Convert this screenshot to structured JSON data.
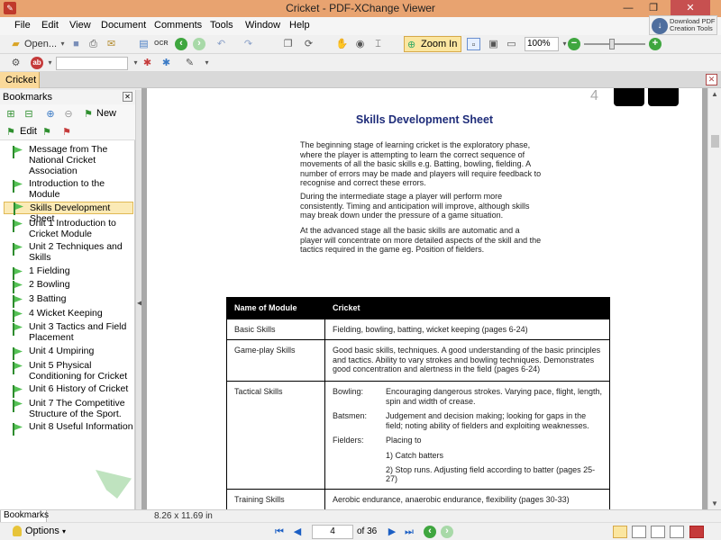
{
  "window": {
    "title": "Cricket - PDF-XChange Viewer"
  },
  "menu": [
    "File",
    "Edit",
    "View",
    "Document",
    "Comments",
    "Tools",
    "Window",
    "Help"
  ],
  "download": {
    "line1": "Download PDF",
    "line2": "Creation Tools"
  },
  "toolbar": {
    "open_label": "Open...",
    "ocr_label": "OCR",
    "zoom_label": "Zoom In",
    "zoom_percent": "100%"
  },
  "tab": {
    "label": "Cricket"
  },
  "bookmarks_panel": {
    "title": "Bookmarks",
    "new_label": "New",
    "edit_label": "Edit",
    "items": [
      "Message from The National Cricket Association",
      "Introduction to the Module",
      "Skills Development Sheet",
      "Unit 1 Introduction to Cricket Module",
      "Unit 2  Techniques and Skills",
      "1 Fielding",
      "2 Bowling",
      "3 Batting",
      "4 Wicket Keeping",
      "Unit 3  Tactics and Field Placement",
      "Unit 4  Umpiring",
      "Unit 5  Physical Conditioning for Cricket",
      "Unit 6 History of Cricket",
      "Unit 7 The Competitive Structure of the Sport.",
      "Unit 8  Useful Information"
    ],
    "selected_index": 2
  },
  "document": {
    "header_number": "4",
    "title": "Skills Development Sheet",
    "paragraphs": [
      "The beginning stage of learning cricket is the exploratory phase, where the player is attempting to learn the correct sequence of movements of all the basic skills e.g. Batting, bowling, fielding.  A number of errors may be made and players will require feedback to recognise and correct these errors.",
      "During the intermediate stage a player will perform more consistently. Timing and anticipation will improve, although skills may break down under the pressure of a game situation.",
      "At the advanced stage all the basic skills are automatic and a player will concentrate on more detailed aspects of the skill and the tactics required in the game eg. Position of fielders."
    ],
    "table": {
      "header": [
        "Name of Module",
        "Cricket"
      ],
      "rows": {
        "basic_skills": {
          "name": "Basic Skills",
          "desc": "Fielding, bowling, batting, wicket keeping (pages 6-24)"
        },
        "gameplay": {
          "name": "Game-play Skills",
          "desc": "Good basic skills, techniques. A good understanding of the basic principles and tactics. Ability to vary strokes and bowling techniques. Demonstrates good concentration and alertness in the field (pages 6-24)"
        },
        "tactical": {
          "name": "Tactical Skills",
          "bowling_key": "Bowling:",
          "bowling_val": "Encouraging dangerous strokes. Varying pace, flight, length, spin and width of crease.",
          "batsmen_key": "Batsmen:",
          "batsmen_val": "Judgement and decision making; looking for gaps in the field; noting ability of fielders and exploiting weaknesses.",
          "fielders_key": "Fielders:",
          "fielders_val": "Placing to",
          "fielders_item1": "1) Catch batters",
          "fielders_item2": "2) Stop runs. Adjusting field according to batter (pages 25-27)"
        },
        "training": {
          "name": "Training Skills",
          "desc": "Aerobic endurance, anaerobic endurance, flexibility (pages 30-33)"
        }
      }
    }
  },
  "status": {
    "bookmarks_tab": "Bookmarks",
    "page_size": "8.26 x 11.69 in"
  },
  "nav": {
    "options_label": "Options",
    "current_page": "4",
    "of_total": "of 36"
  }
}
